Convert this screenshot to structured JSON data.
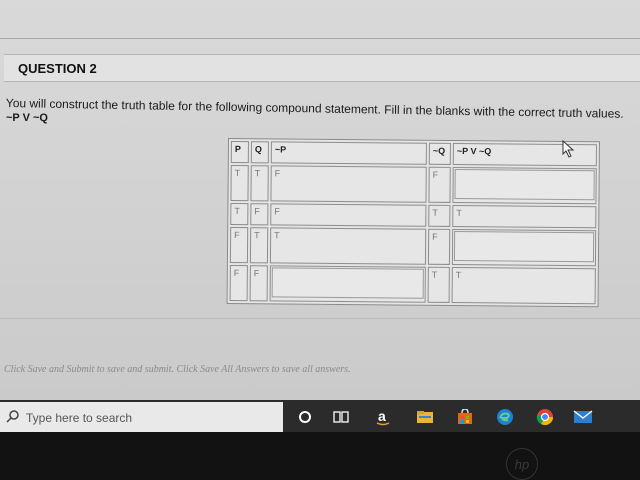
{
  "question": {
    "title": "QUESTION 2",
    "prompt": "You will construct the truth table for the following compound statement. Fill in the blanks with the correct truth values.",
    "statement": "~P V ~Q"
  },
  "table": {
    "headers": [
      "P",
      "Q",
      "~P",
      "~Q",
      "~P V ~Q"
    ],
    "rows": [
      {
        "p": "T",
        "q": "T",
        "notp": "F",
        "notq": "F",
        "result": ""
      },
      {
        "p": "T",
        "q": "F",
        "notp": "F",
        "notq": "T",
        "result": "T"
      },
      {
        "p": "F",
        "q": "T",
        "notp": "T",
        "notq": "F",
        "result": ""
      },
      {
        "p": "F",
        "q": "F",
        "notp": "",
        "notq": "T",
        "result": "T"
      }
    ]
  },
  "footer": {
    "note": "Click Save and Submit to save and submit. Click Save All Answers to save all answers."
  },
  "taskbar": {
    "search_placeholder": "Type here to search",
    "icons": [
      "cortana-icon",
      "task-view-icon",
      "amazon-icon",
      "file-explorer-icon",
      "store-icon",
      "edge-icon",
      "chrome-icon",
      "mail-icon"
    ]
  },
  "bezel": {
    "logo": "hp"
  },
  "colors": {
    "edge": "#1f7fd6",
    "folder": "#e8b53a",
    "store": "#d96a1d",
    "chrome_red": "#db4437",
    "chrome_green": "#0f9d58",
    "chrome_yellow": "#f4b400",
    "mail": "#2a7fcf"
  }
}
